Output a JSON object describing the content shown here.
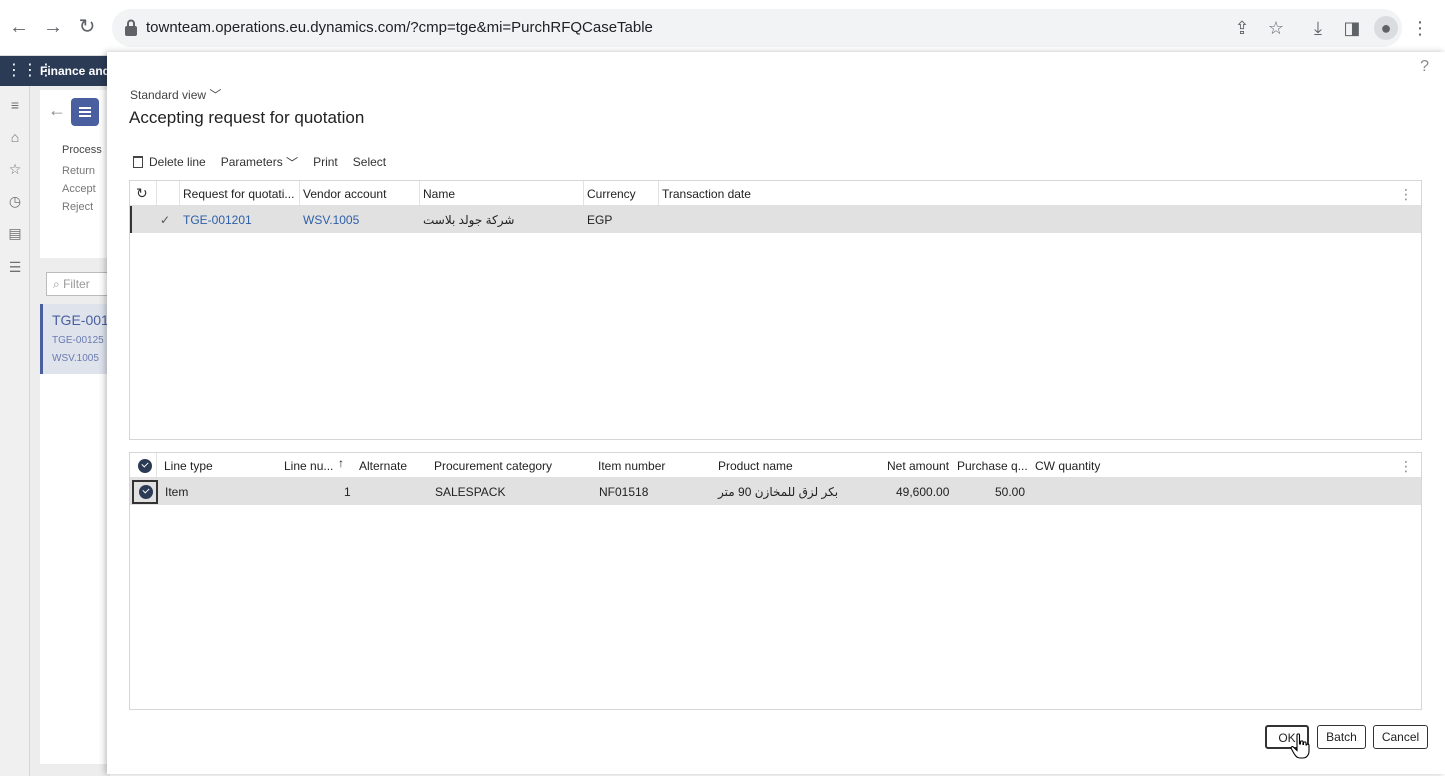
{
  "browser": {
    "url": "townteam.operations.eu.dynamics.com/?cmp=tge&mi=PurchRFQCaseTable"
  },
  "app": {
    "name": "Finance and",
    "bg_process_label": "Process",
    "bg_actions": [
      "Return",
      "Accept",
      "Reject"
    ],
    "bg_filter_placeholder": "Filter",
    "bg_list_main": "TGE-001",
    "bg_list_sub1": "TGE-00125",
    "bg_list_sub2": "WSV.1005"
  },
  "dialog": {
    "help": "?",
    "view_selector": "Standard view",
    "title": "Accepting request for quotation",
    "toolbar": {
      "delete_line": "Delete line",
      "parameters": "Parameters",
      "print": "Print",
      "select": "Select"
    },
    "rfq_grid": {
      "headers": [
        "Request for quotati...",
        "Vendor account",
        "Name",
        "Currency",
        "Transaction date"
      ],
      "rows": [
        {
          "rfq": "TGE-001201",
          "vendor_account": "WSV.1005",
          "name": "شركة جولد بلاست",
          "currency": "EGP",
          "transaction_date": ""
        }
      ]
    },
    "lines_grid": {
      "headers": [
        "Line type",
        "Line nu...",
        "Alternate",
        "Procurement category",
        "Item number",
        "Product name",
        "Net amount",
        "Purchase q...",
        "CW quantity"
      ],
      "sort_indicator": "↑",
      "rows": [
        {
          "line_type": "Item",
          "line_number": "1",
          "alternate": "",
          "procurement_category": "SALESPACK",
          "item_number": "NF01518",
          "product_name": "بكر لزق للمخازن 90 متر",
          "net_amount": "49,600.00",
          "purchase_qty": "50.00",
          "cw_quantity": ""
        }
      ]
    },
    "buttons": {
      "ok": "OK",
      "batch": "Batch",
      "cancel": "Cancel"
    }
  }
}
